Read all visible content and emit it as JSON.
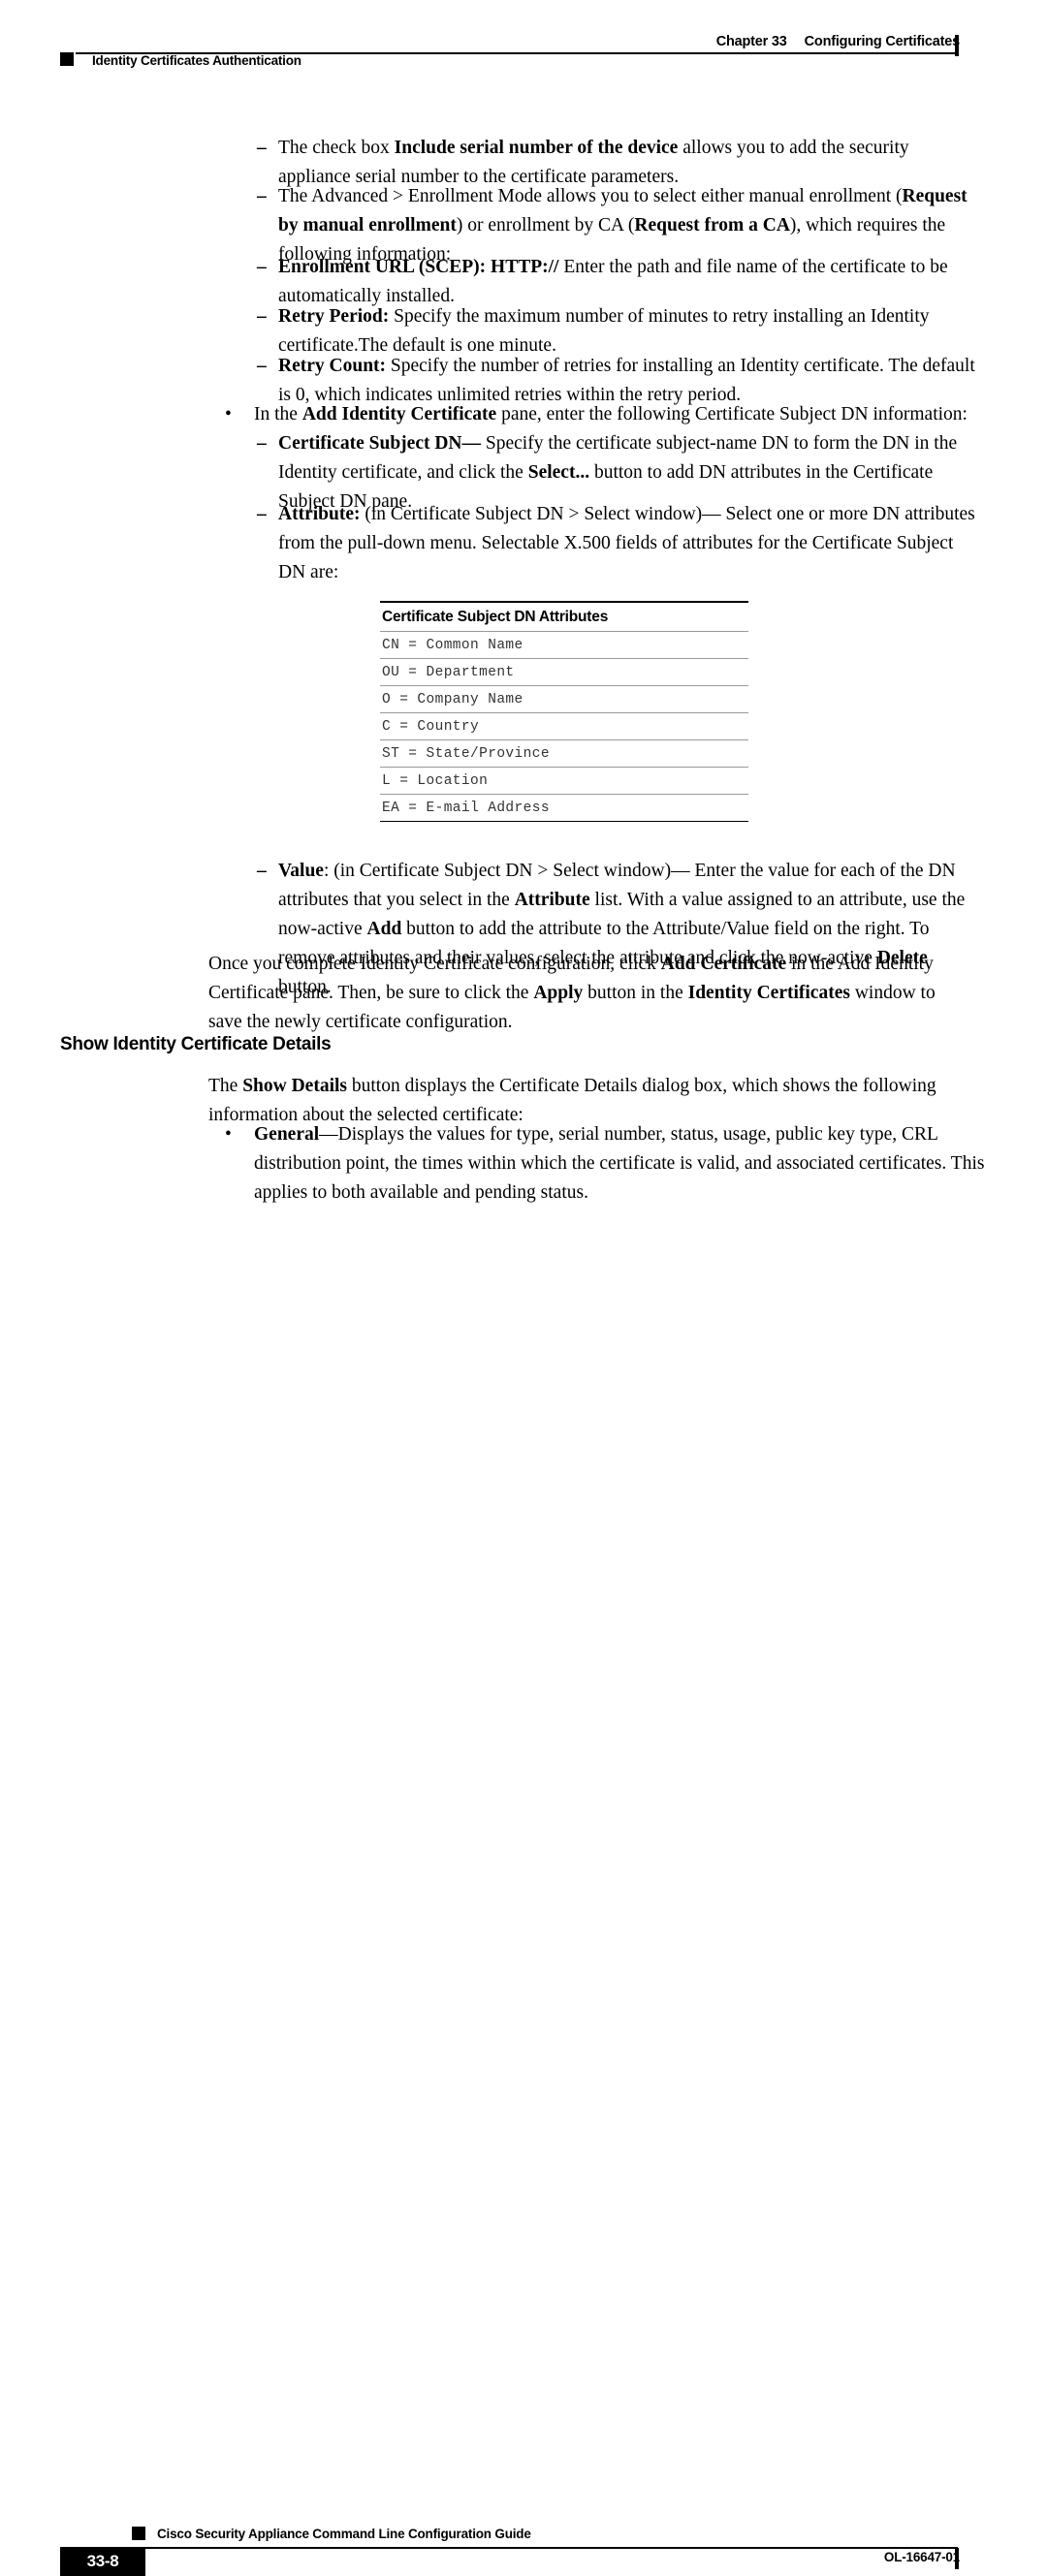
{
  "header": {
    "chapter_number": "Chapter 33",
    "chapter_title": "Configuring Certificates",
    "section_title": "Identity Certificates Authentication"
  },
  "body": {
    "dash_glyph": "–",
    "bullet_glyph": "•",
    "items": [
      {
        "id": "include-serial-number",
        "runs": [
          {
            "t": "The check box ",
            "b": false
          },
          {
            "t": "Include serial number of the device",
            "b": true
          },
          {
            "t": " allows you to add the security appliance serial number to the certificate parameters.",
            "b": false
          }
        ]
      },
      {
        "id": "advanced-enrollment-mode",
        "runs": [
          {
            "t": "The Advanced > Enrollment Mode allows you to select either manual enrollment (",
            "b": false
          },
          {
            "t": "Request by manual enrollment",
            "b": true
          },
          {
            "t": ") or enrollment by CA (",
            "b": false
          },
          {
            "t": "Request from a CA",
            "b": true
          },
          {
            "t": "), which requires the following information:",
            "b": false
          }
        ]
      },
      {
        "id": "enrollment-url",
        "runs": [
          {
            "t": "Enrollment URL (SCEP): HTTP://",
            "b": true
          },
          {
            "t": " Enter the path and file name of the certificate to be automatically installed.",
            "b": false
          }
        ]
      },
      {
        "id": "retry-period",
        "runs": [
          {
            "t": "Retry Period:",
            "b": true
          },
          {
            "t": " Specify the maximum number of minutes to retry installing an Identity certificate.The default is one minute.",
            "b": false
          }
        ]
      },
      {
        "id": "retry-count",
        "runs": [
          {
            "t": "Retry Count:",
            "b": true
          },
          {
            "t": " Specify the number of retries for installing an Identity certificate. The default is 0, which indicates unlimited retries within the retry period.",
            "b": false
          }
        ]
      },
      {
        "id": "add-identity-certificate-pane",
        "runs": [
          {
            "t": "In the ",
            "b": false
          },
          {
            "t": "Add Identity Certificate",
            "b": true
          },
          {
            "t": " pane, enter the following Certificate Subject DN information:",
            "b": false
          }
        ]
      },
      {
        "id": "certificate-subject-dn",
        "runs": [
          {
            "t": "Certificate Subject DN—",
            "b": true
          },
          {
            "t": " Specify the certificate subject-name DN to form the DN in the Identity certificate, and click the ",
            "b": false
          },
          {
            "t": "Select...",
            "b": true
          },
          {
            "t": " button to add DN attributes in the Certificate Subject DN pane.",
            "b": false
          }
        ]
      },
      {
        "id": "attribute",
        "runs": [
          {
            "t": "Attribute:",
            "b": true
          },
          {
            "t": " (in Certificate Subject DN > Select window)— Select one or more DN attributes from the pull-down menu. Selectable X.500 fields of attributes for the Certificate Subject DN are:",
            "b": false
          }
        ]
      },
      {
        "id": "value",
        "runs": [
          {
            "t": "Value",
            "b": true
          },
          {
            "t": ": (in Certificate Subject DN > Select window)— Enter the value for each of the DN attributes that you select in the ",
            "b": false
          },
          {
            "t": "Attribute",
            "b": true
          },
          {
            "t": " list. With a value assigned to an attribute, use the now-active ",
            "b": false
          },
          {
            "t": "Add",
            "b": true
          },
          {
            "t": " button to add the attribute to the Attribute/Value field on the right. To remove attributes and their values, select the attribute and click the now-active ",
            "b": false
          },
          {
            "t": "Delete",
            "b": true
          },
          {
            "t": " button.",
            "b": false
          }
        ]
      },
      {
        "id": "once-you-complete",
        "runs": [
          {
            "t": "Once you complete Identity Certificate configuration, click ",
            "b": false
          },
          {
            "t": "Add Certificate",
            "b": true
          },
          {
            "t": " in the Add Identity Certificate pane. Then, be sure to click the ",
            "b": false
          },
          {
            "t": "Apply",
            "b": true
          },
          {
            "t": " button in the ",
            "b": false
          },
          {
            "t": "Identity Certificates",
            "b": true
          },
          {
            "t": " window to save the newly certificate configuration.",
            "b": false
          }
        ]
      },
      {
        "id": "show-details-intro",
        "runs": [
          {
            "t": "The ",
            "b": false
          },
          {
            "t": "Show Details",
            "b": true
          },
          {
            "t": " button displays the Certificate Details dialog box, which shows the following information about the selected certificate:",
            "b": false
          }
        ]
      },
      {
        "id": "general",
        "runs": [
          {
            "t": "General",
            "b": true
          },
          {
            "t": "—Displays the values for type, serial number, status, usage, public key type, CRL distribution point, the times within which the certificate is valid, and associated certificates. This applies to both available and pending status.",
            "b": false
          }
        ]
      }
    ],
    "section_heading": "Show Identity Certificate Details"
  },
  "table": {
    "title": "Certificate Subject DN Attributes",
    "rows": [
      "CN = Common Name",
      "OU = Department",
      "O = Company Name",
      "C = Country",
      "ST = State/Province",
      "L = Location",
      "EA = E-mail Address"
    ]
  },
  "footer": {
    "guide_title": "Cisco Security Appliance Command Line Configuration Guide",
    "page_number": "33-8",
    "doc_id": "OL-16647-01"
  }
}
